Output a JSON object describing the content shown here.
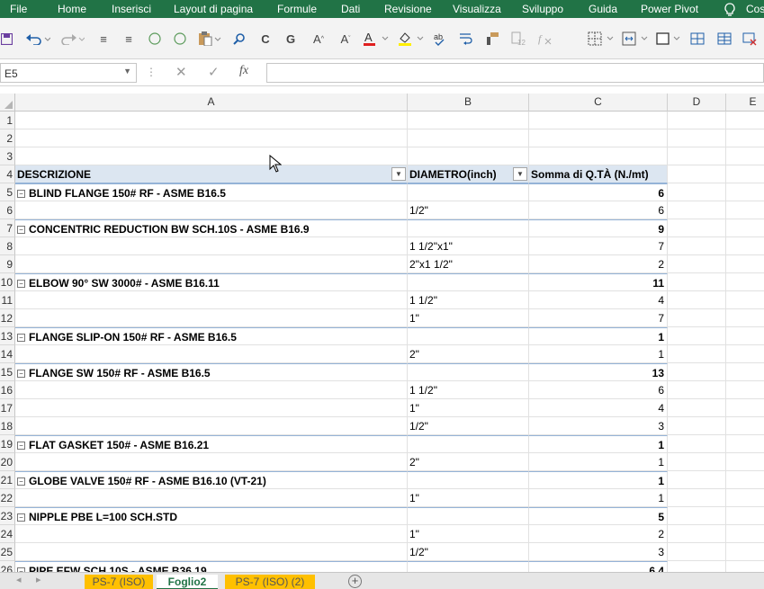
{
  "menu": [
    "File",
    "Home",
    "Inserisci",
    "Layout di pagina",
    "Formule",
    "Dati",
    "Revisione",
    "Visualizza",
    "Sviluppo",
    "Guida",
    "Power Pivot",
    "Cos"
  ],
  "formula_bar": {
    "name_box": "E5",
    "fx": "fx",
    "content": ""
  },
  "columns": [
    "A",
    "B",
    "C",
    "D",
    "E"
  ],
  "pivot": {
    "header": {
      "a": "DESCRIZIONE",
      "b": "DIAMETRO(inch)",
      "c": "Somma di Q.TÀ (N./mt)"
    },
    "rows": [
      {
        "n": "1",
        "a": "",
        "b": "",
        "c": "",
        "type": "empty"
      },
      {
        "n": "2",
        "a": "",
        "b": "",
        "c": "",
        "type": "empty"
      },
      {
        "n": "3",
        "a": "",
        "b": "",
        "c": "",
        "type": "empty"
      },
      {
        "n": "4",
        "type": "header"
      },
      {
        "n": "5",
        "a": "BLIND FLANGE 150# RF - ASME B16.5",
        "b": "",
        "c": "6",
        "type": "group"
      },
      {
        "n": "6",
        "a": "",
        "b": "1/2\"",
        "c": "6",
        "type": "item"
      },
      {
        "n": "7",
        "a": "CONCENTRIC REDUCTION BW SCH.10S - ASME B16.9",
        "b": "",
        "c": "9",
        "type": "group"
      },
      {
        "n": "8",
        "a": "",
        "b": "1 1/2\"x1\"",
        "c": "7",
        "type": "item"
      },
      {
        "n": "9",
        "a": "",
        "b": "2\"x1 1/2\"",
        "c": "2",
        "type": "item"
      },
      {
        "n": "10",
        "a": "ELBOW 90° SW 3000# - ASME B16.11",
        "b": "",
        "c": "11",
        "type": "group"
      },
      {
        "n": "11",
        "a": "",
        "b": "1 1/2\"",
        "c": "4",
        "type": "item"
      },
      {
        "n": "12",
        "a": "",
        "b": "1\"",
        "c": "7",
        "type": "item"
      },
      {
        "n": "13",
        "a": "FLANGE SLIP-ON 150# RF - ASME B16.5",
        "b": "",
        "c": "1",
        "type": "group"
      },
      {
        "n": "14",
        "a": "",
        "b": "2\"",
        "c": "1",
        "type": "item"
      },
      {
        "n": "15",
        "a": "FLANGE SW 150# RF - ASME B16.5",
        "b": "",
        "c": "13",
        "type": "group"
      },
      {
        "n": "16",
        "a": "",
        "b": "1 1/2\"",
        "c": "6",
        "type": "item"
      },
      {
        "n": "17",
        "a": "",
        "b": "1\"",
        "c": "4",
        "type": "item"
      },
      {
        "n": "18",
        "a": "",
        "b": "1/2\"",
        "c": "3",
        "type": "item"
      },
      {
        "n": "19",
        "a": "FLAT GASKET 150# - ASME B16.21",
        "b": "",
        "c": "1",
        "type": "group"
      },
      {
        "n": "20",
        "a": "",
        "b": "2\"",
        "c": "1",
        "type": "item"
      },
      {
        "n": "21",
        "a": "GLOBE VALVE 150# RF - ASME B16.10 (VT-21)",
        "b": "",
        "c": "1",
        "type": "group"
      },
      {
        "n": "22",
        "a": "",
        "b": "1\"",
        "c": "1",
        "type": "item"
      },
      {
        "n": "23",
        "a": "NIPPLE PBE L=100 SCH.STD",
        "b": "",
        "c": "5",
        "type": "group"
      },
      {
        "n": "24",
        "a": "",
        "b": "1\"",
        "c": "2",
        "type": "item"
      },
      {
        "n": "25",
        "a": "",
        "b": "1/2\"",
        "c": "3",
        "type": "item"
      },
      {
        "n": "26",
        "a": "PIPE EFW SCH.10S - ASME B36.19",
        "b": "",
        "c": "6.4",
        "type": "group"
      }
    ]
  },
  "sheet_tabs": [
    {
      "label": "PS-7 (ISO)",
      "active": false
    },
    {
      "label": "Foglio2",
      "active": true
    },
    {
      "label": "PS-7 (ISO) (2)",
      "active": false
    }
  ],
  "colors": {
    "excel_green": "#217346",
    "pivot_header": "#dce6f1",
    "tab_orange": "#ffc000"
  }
}
